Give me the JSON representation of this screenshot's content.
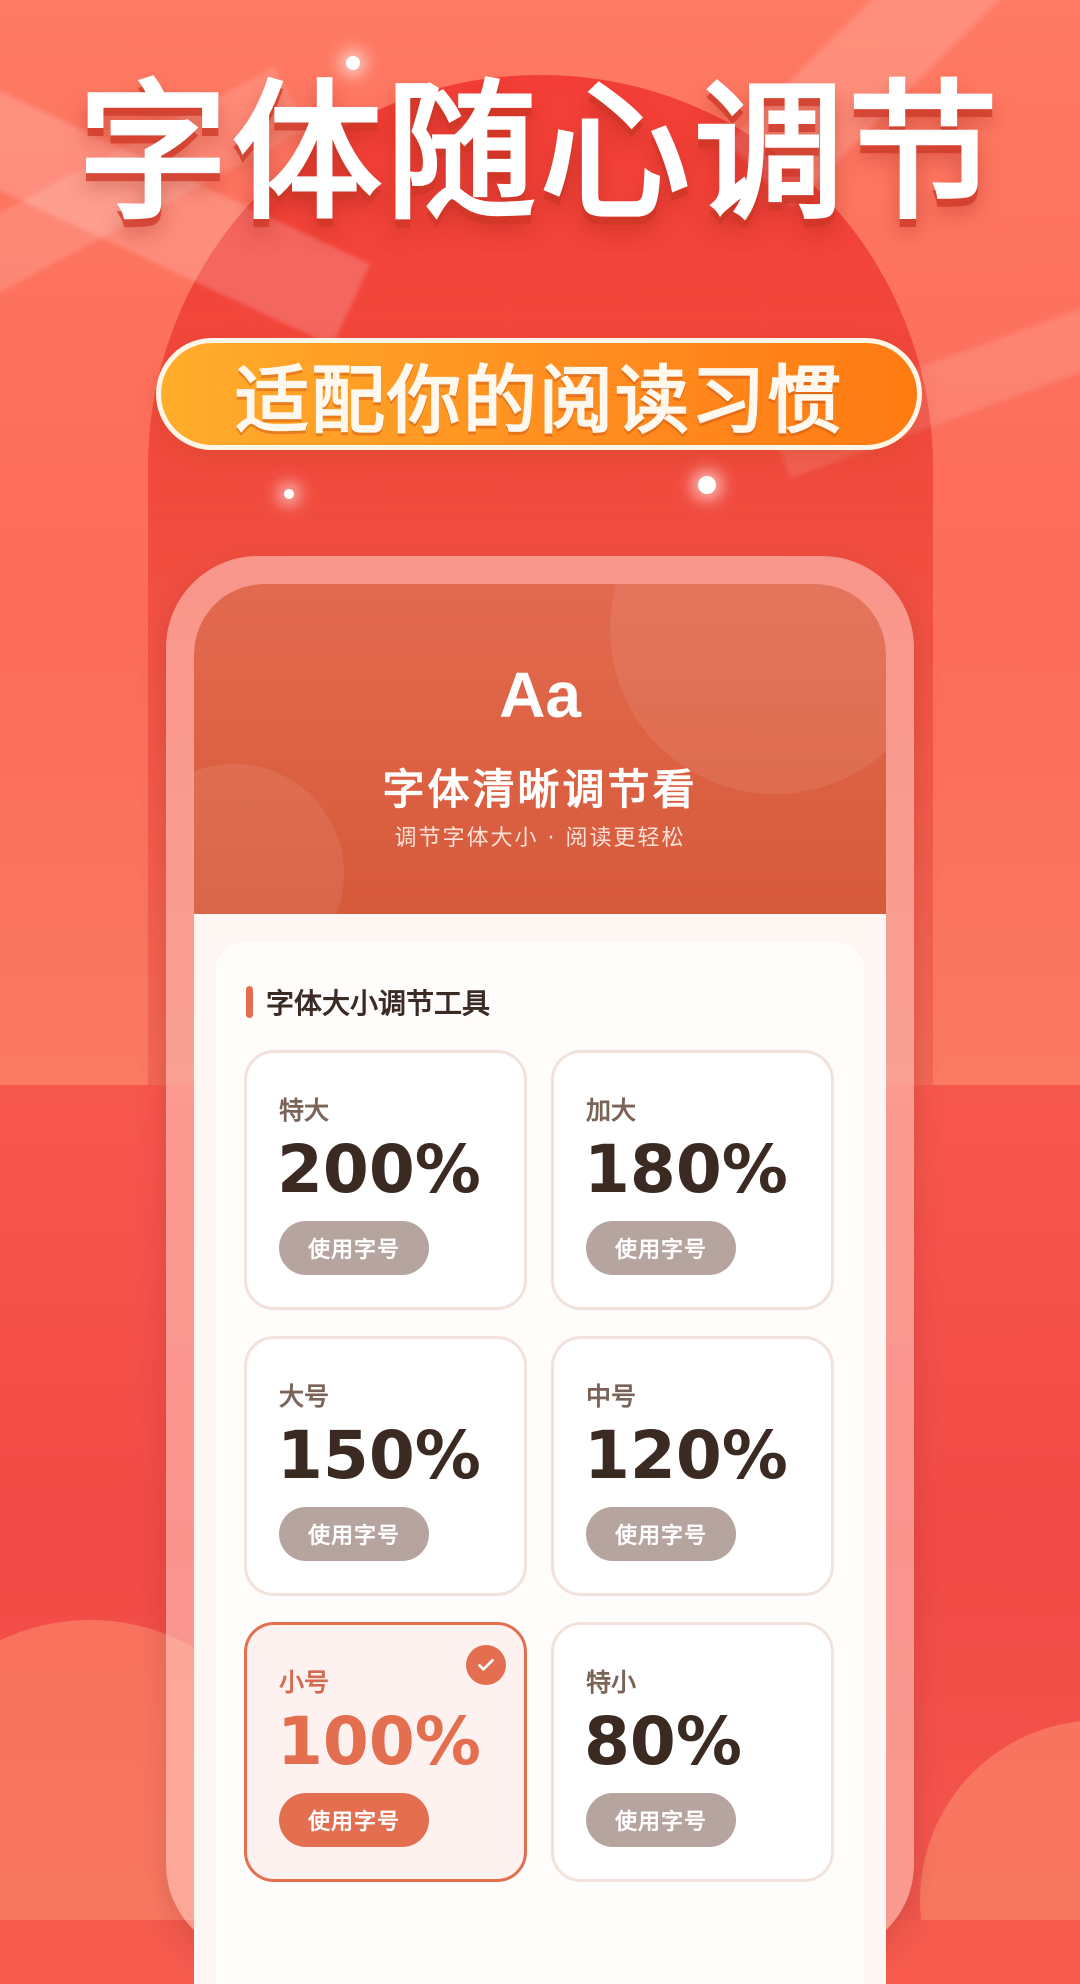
{
  "banner": {
    "headline": "字体随心调节",
    "subtitle": "适配你的阅读习惯"
  },
  "hero": {
    "icon_text": "Aa",
    "title": "字体清晰调节看",
    "subtitle": "调节字体大小 · 阅读更轻松"
  },
  "tool": {
    "section_title": "字体大小调节工具",
    "options": [
      {
        "label": "特大",
        "value": "200%",
        "button": "使用字号",
        "selected": false
      },
      {
        "label": "加大",
        "value": "180%",
        "button": "使用字号",
        "selected": false
      },
      {
        "label": "大号",
        "value": "150%",
        "button": "使用字号",
        "selected": false
      },
      {
        "label": "中号",
        "value": "120%",
        "button": "使用字号",
        "selected": false
      },
      {
        "label": "小号",
        "value": "100%",
        "button": "使用字号",
        "selected": true
      },
      {
        "label": "特小",
        "value": "80%",
        "button": "使用字号",
        "selected": false
      }
    ]
  },
  "icons": {
    "selected_indicator": "check-icon"
  },
  "colors": {
    "accent": "#e36e50",
    "button_gray": "#b6a49f",
    "pill_orange": "#ff8b1e"
  }
}
